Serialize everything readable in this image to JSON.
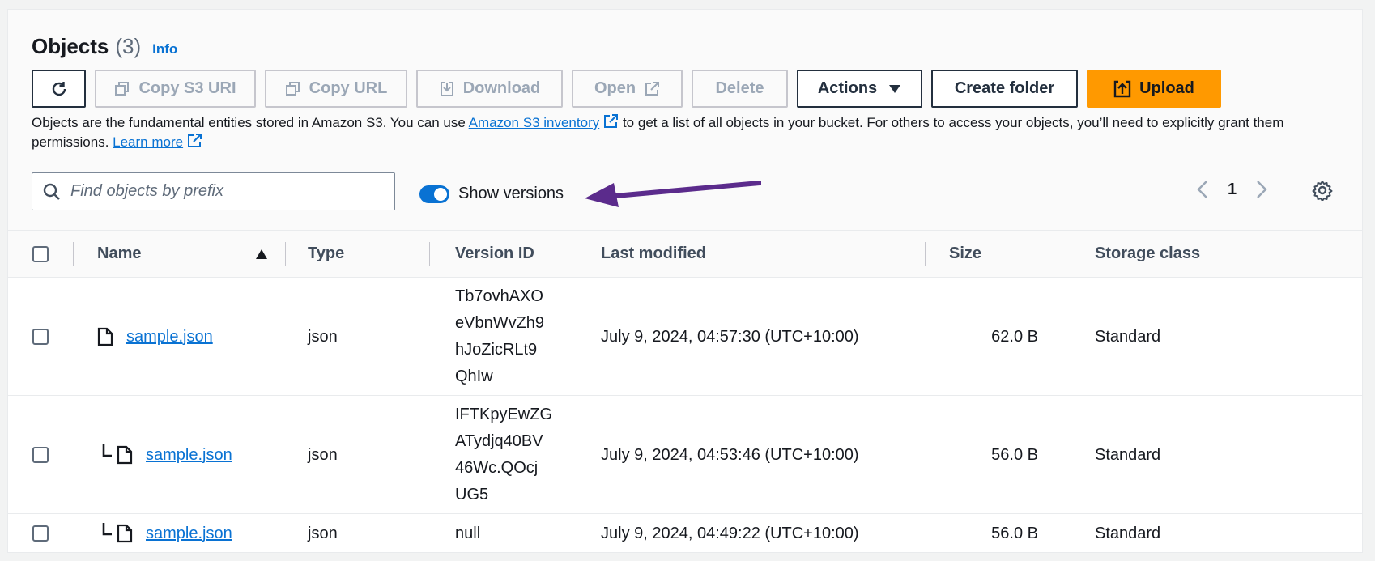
{
  "header": {
    "title": "Objects",
    "count": "(3)",
    "info_link": "Info"
  },
  "toolbar": {
    "refresh_icon": "refresh-icon",
    "copy_s3_uri": "Copy S3 URI",
    "copy_url": "Copy URL",
    "download": "Download",
    "open": "Open",
    "delete": "Delete",
    "actions": "Actions",
    "create_folder": "Create folder",
    "upload": "Upload"
  },
  "description": {
    "part1": "Objects are the fundamental entities stored in Amazon S3. You can use ",
    "link1": "Amazon S3 inventory",
    "part2": " to get a list of all objects in your bucket. For others to access your objects, you’ll need to explicitly grant them permissions. ",
    "link2": "Learn more"
  },
  "search": {
    "placeholder": "Find objects by prefix",
    "value": ""
  },
  "versions_toggle": {
    "label": "Show versions",
    "on": true
  },
  "pagination": {
    "current_page": "1"
  },
  "table": {
    "columns": [
      "Name",
      "Type",
      "Version ID",
      "Last modified",
      "Size",
      "Storage class"
    ],
    "rows": [
      {
        "name": "sample.json",
        "type": "json",
        "version_id": [
          "Tb7ovhAXO",
          "eVbnWvZh9",
          "hJoZicRLt9",
          "QhIw"
        ],
        "last_modified": "July 9, 2024, 04:57:30 (UTC+10:00)",
        "size": "62.0 B",
        "storage_class": "Standard"
      },
      {
        "name": "sample.json",
        "type": "json",
        "version_id": [
          "IFTKpyEwZG",
          "ATydjq40BV",
          "46Wc.QOcj",
          "UG5"
        ],
        "last_modified": "July 9, 2024, 04:53:46 (UTC+10:00)",
        "size": "56.0 B",
        "storage_class": "Standard"
      },
      {
        "name": "sample.json",
        "type": "json",
        "version_id": [
          "null"
        ],
        "last_modified": "July 9, 2024, 04:49:22 (UTC+10:00)",
        "size": "56.0 B",
        "storage_class": "Standard"
      }
    ]
  },
  "colors": {
    "accent": "#0972d3",
    "upload": "#ff9900",
    "annotation_arrow": "#5b2b8c"
  }
}
